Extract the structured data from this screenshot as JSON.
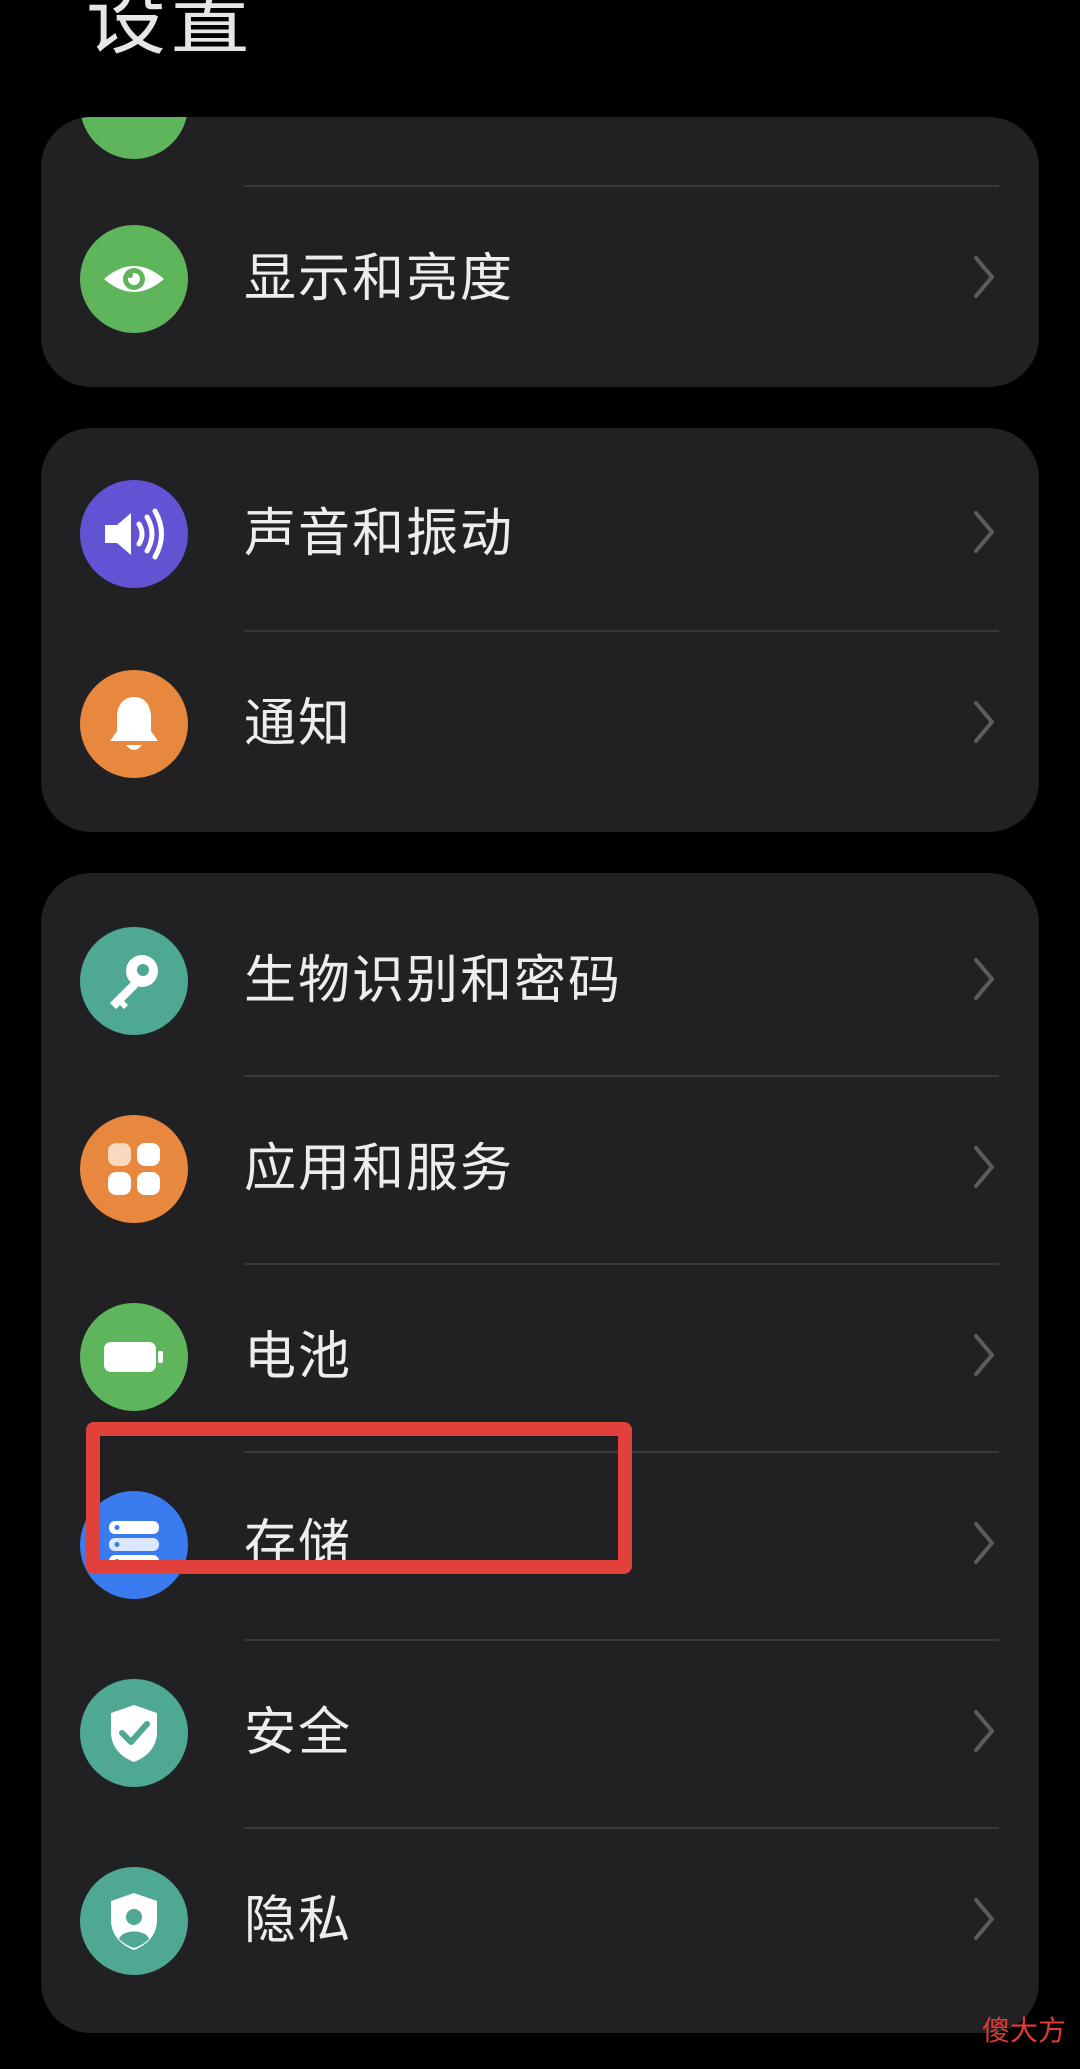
{
  "page": {
    "title": "设置"
  },
  "groups": [
    {
      "items": [
        {
          "label": "",
          "icon": "partial-hidden-icon",
          "icon_color": "#5EB55C"
        },
        {
          "label": "显示和亮度",
          "icon": "eye-icon",
          "icon_color": "#5EB55C"
        }
      ]
    },
    {
      "items": [
        {
          "label": "声音和振动",
          "icon": "speaker-icon",
          "icon_color": "#6153D3"
        },
        {
          "label": "通知",
          "icon": "bell-icon",
          "icon_color": "#E8873E"
        }
      ]
    },
    {
      "items": [
        {
          "label": "生物识别和密码",
          "icon": "key-icon",
          "icon_color": "#4EA894"
        },
        {
          "label": "应用和服务",
          "icon": "apps-grid-icon",
          "icon_color": "#E8873E"
        },
        {
          "label": "电池",
          "icon": "battery-icon",
          "icon_color": "#5EB55C"
        },
        {
          "label": "存储",
          "icon": "storage-icon",
          "icon_color": "#3A7BF0"
        },
        {
          "label": "安全",
          "icon": "shield-check-icon",
          "icon_color": "#4EA894"
        },
        {
          "label": "隐私",
          "icon": "privacy-shield-icon",
          "icon_color": "#4EA894"
        }
      ]
    }
  ],
  "annotation": {
    "highlight_color": "#E2403A",
    "highlighted_item": "存储"
  },
  "watermark": {
    "text": "傻大方"
  }
}
